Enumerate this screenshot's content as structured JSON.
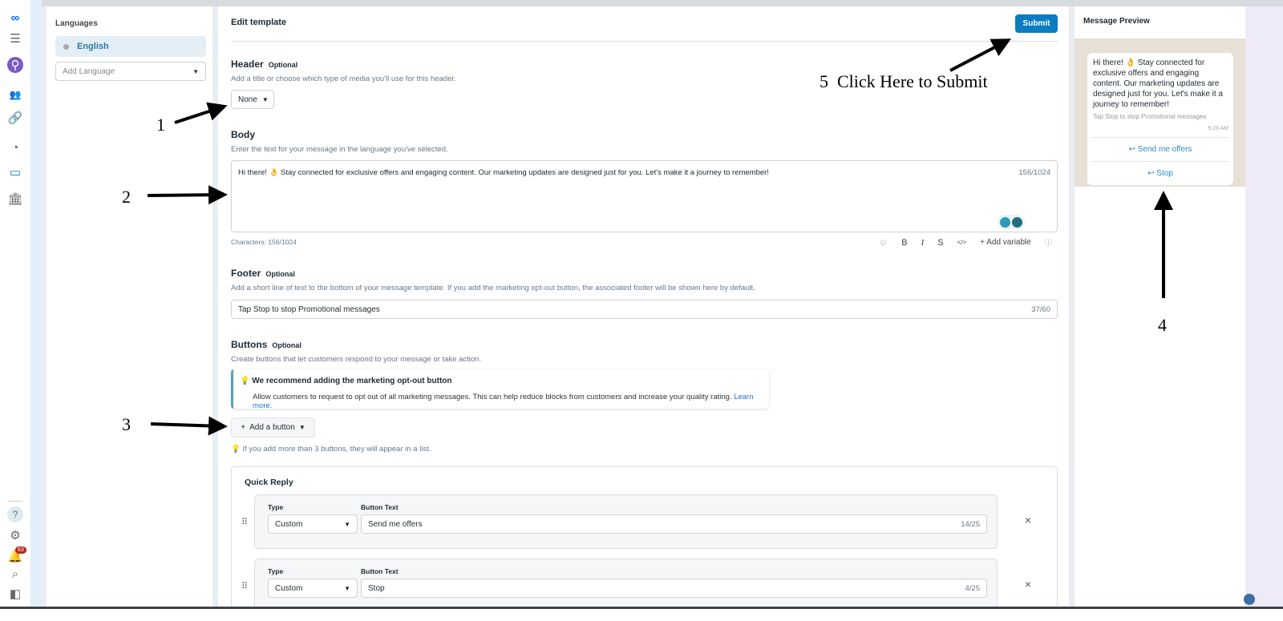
{
  "rail": {
    "notification_count": "63",
    "icons": [
      "meta-logo-icon",
      "menu-icon",
      "profile-icon",
      "audience-icon",
      "link-icon",
      "gauge-icon",
      "briefcase-icon",
      "bank-icon",
      "help-icon",
      "settings-icon",
      "bell-icon",
      "search-icon",
      "panel-toggle-icon"
    ]
  },
  "languages": {
    "title": "Languages",
    "selected": "English",
    "add_placeholder": "Add Language"
  },
  "editor": {
    "title": "Edit template",
    "submit": "Submit",
    "header": {
      "label": "Header",
      "optional": "Optional",
      "desc": "Add a title or choose which type of media you'll use for this header.",
      "value": "None"
    },
    "body": {
      "label": "Body",
      "desc": "Enter the text for your message in the language you've selected.",
      "text": "Hi there! 👌 Stay connected for exclusive offers and engaging content. Our marketing updates are designed just for you. Let's make it a journey to remember!",
      "count": "156/1024",
      "characters": "Characters: 156/1024",
      "toolbar": {
        "bold": "B",
        "italic": "I",
        "strike": "S",
        "code": "</>",
        "add_variable": "+ Add variable"
      }
    },
    "footer": {
      "label": "Footer",
      "optional": "Optional",
      "desc": "Add a short line of text to the bottom of your message template. If you add the marketing opt-out button, the associated footer will be shown here by default.",
      "value": "Tap Stop to stop Promotional messages",
      "count": "37/60"
    },
    "buttons": {
      "label": "Buttons",
      "optional": "Optional",
      "desc": "Create buttons that let customers respond to your message or take action.",
      "tip_title": "We recommend adding the marketing opt-out button",
      "tip_text": "Allow customers to request to opt out of all marketing messages. This can help reduce blocks from customers and increase your quality rating.",
      "learn_more": "Learn more.",
      "add_button": "Add a button",
      "hint": "If you add more than 3 buttons, they will appear in a list.",
      "quick_reply": {
        "title": "Quick Reply",
        "type_label": "Type",
        "text_label": "Button Text",
        "rows": [
          {
            "type": "Custom",
            "text": "Send me offers",
            "count": "14/25"
          },
          {
            "type": "Custom",
            "text": "Stop",
            "count": "4/25"
          }
        ]
      }
    }
  },
  "preview": {
    "title": "Message Preview",
    "body": "Hi there! 👌 Stay connected for exclusive offers and engaging content. Our marketing updates are designed just for you. Let's make it a journey to remember!",
    "footer": "Tap Stop to stop Promotional messages",
    "time": "9:28 AM",
    "buttons": [
      "Send me offers",
      "Stop"
    ]
  },
  "annotations": {
    "a1": "1",
    "a2": "2",
    "a3": "3",
    "a4": "4",
    "a5": "5  Click Here to Submit"
  },
  "colors": {
    "accent": "#0a7cc1",
    "link": "#216fdb"
  }
}
